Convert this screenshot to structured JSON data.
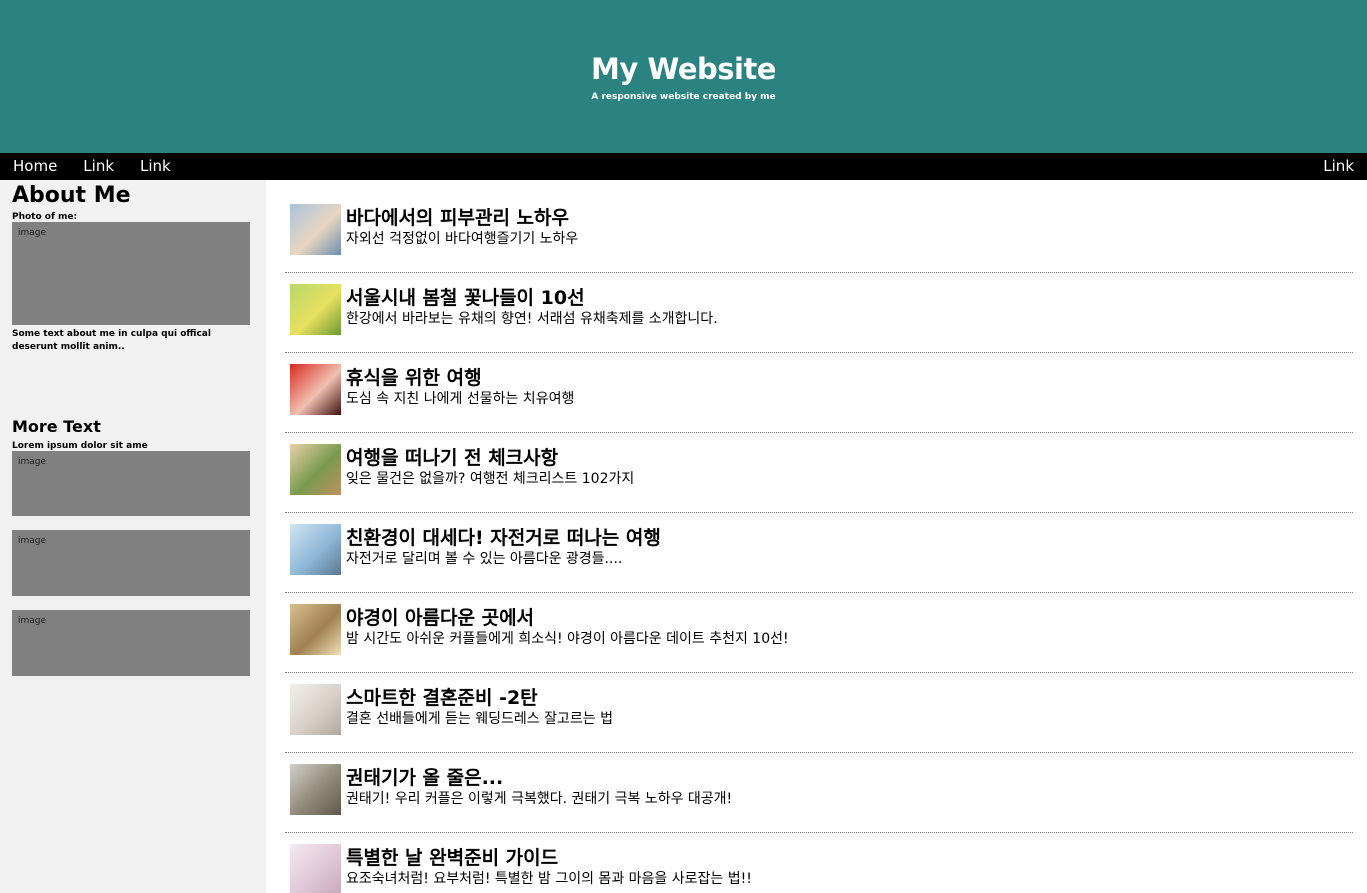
{
  "header": {
    "title": "My Website",
    "subtitle": "A responsive website created by me"
  },
  "nav": {
    "items": [
      "Home",
      "Link",
      "Link"
    ],
    "right_item": "Link"
  },
  "sidebar": {
    "about_title": "About Me",
    "photo_label": "Photo of me:",
    "image_text": "image",
    "about_text": "Some text about me in culpa qui offical deserunt mollit anim..",
    "more_title": "More Text",
    "more_text": "Lorem ipsum dolor sit ame"
  },
  "articles": [
    {
      "title": "바다에서의 피부관리 노하우",
      "desc": "자외선 걱정없이 바다여행즐기기 노하우",
      "thumb_colors": [
        "#a8c4dc",
        "#e8d6c0",
        "#6a8fb0"
      ]
    },
    {
      "title": "서울시내 봄철 꽃나들이 10선",
      "desc": "한강에서 바라보는 유채의 향연! 서래섬 유채축제를 소개합니다.",
      "thumb_colors": [
        "#b8d86a",
        "#e8e060",
        "#6a9a30"
      ]
    },
    {
      "title": "휴식을 위한 여행",
      "desc": "도심 속 지친 나에게 선물하는 치유여행",
      "thumb_colors": [
        "#d82a20",
        "#f0c0b0",
        "#401010"
      ]
    },
    {
      "title": "여행을 떠나기 전 체크사항",
      "desc": "잊은 물건은 없을까? 여행전 체크리스트 102가지",
      "thumb_colors": [
        "#e8d0a8",
        "#7a9a50",
        "#c09060"
      ]
    },
    {
      "title": "친환경이 대세다! 자전거로 떠나는 여행",
      "desc": "자전거로 달리며 볼 수 있는 아름다운 광경들....",
      "thumb_colors": [
        "#cfe4f0",
        "#8fb8d8",
        "#5a7890"
      ]
    },
    {
      "title": "야경이 아름다운 곳에서",
      "desc": "밤 시간도 아쉬운 커플들에게 희소식! 야경이 아름다운 데이트 추천지 10선!",
      "thumb_colors": [
        "#d8c090",
        "#a08050",
        "#f0e0b8"
      ]
    },
    {
      "title": "스마트한 결혼준비 -2탄",
      "desc": "결혼 선배들에게 듣는 웨딩드레스 잘고르는 법",
      "thumb_colors": [
        "#f2f0ec",
        "#d8d0c8",
        "#b0a8a0"
      ]
    },
    {
      "title": "권태기가 올 줄은...",
      "desc": "권태기! 우리 커플은 이렇게 극복했다. 권태기 극복 노하우 대공개!",
      "thumb_colors": [
        "#d0d0c8",
        "#908878",
        "#605848"
      ]
    },
    {
      "title": "특별한 날 완벽준비 가이드",
      "desc": "요조숙녀처럼! 요부처럼! 특별한 밤 그이의 몸과 마음을 사로잡는 법!!",
      "thumb_colors": [
        "#f4e8ee",
        "#e0c8d8",
        "#c8a8b8"
      ]
    }
  ]
}
